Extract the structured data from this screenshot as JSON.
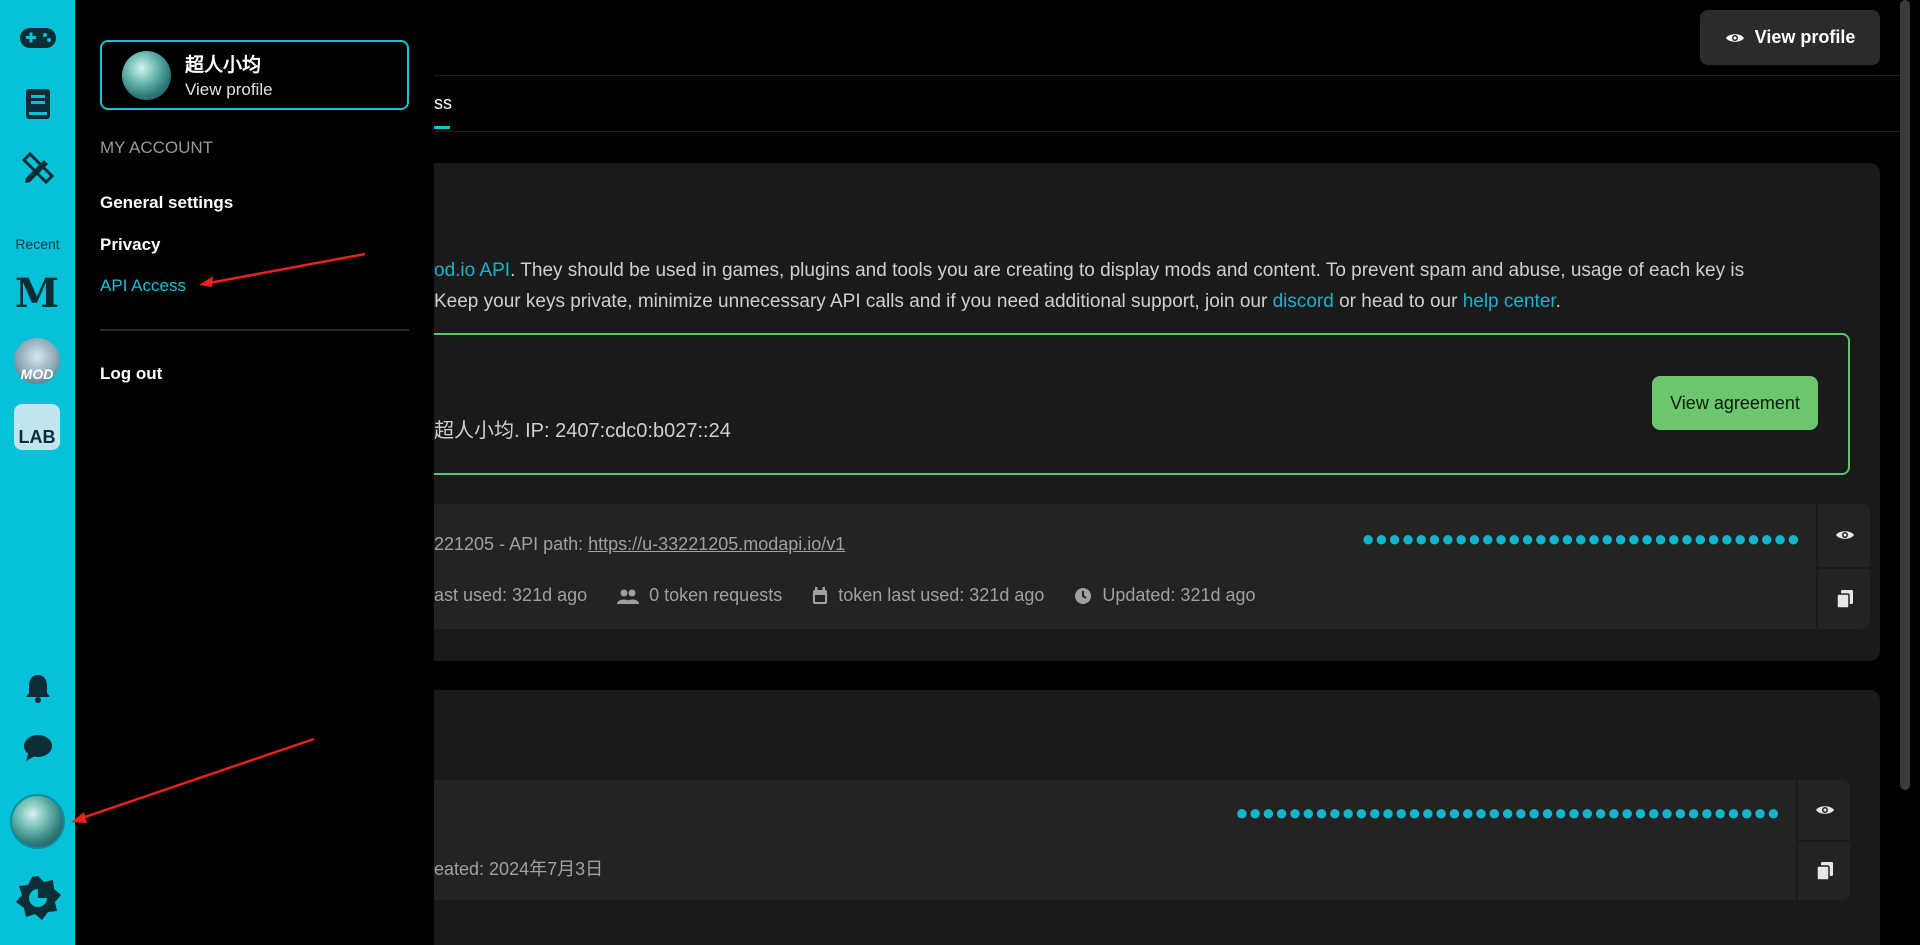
{
  "rail": {
    "recent_label": "Recent",
    "recent_tiles": [
      {
        "name": "M",
        "label": "M"
      },
      {
        "name": "MOD",
        "label": "MOD"
      },
      {
        "name": "LAB",
        "label": "LAB"
      }
    ]
  },
  "menu": {
    "profile_name": "超人小均",
    "profile_link": "View profile",
    "heading": "MY ACCOUNT",
    "items": [
      {
        "label": "General settings"
      },
      {
        "label": "Privacy"
      },
      {
        "label": "API Access"
      }
    ],
    "logout": "Log out"
  },
  "main": {
    "view_profile_label": "View profile",
    "tab_fragment": "ss",
    "description_part1": "od.io API",
    "description_part2": ". They should be used in games, plugins and tools you are creating to display mods and content. To prevent spam and abuse, usage of each key is",
    "description_part3": " Keep your keys private, minimize unnecessary API calls and if you need additional support, join our ",
    "description_link_discord": "discord",
    "description_part4": " or head to our ",
    "description_link_help": "help center",
    "description_part5": ".",
    "agreement_owner": "超人小均. IP: 2407:cdc0:b027::24",
    "agreement_button": "View agreement",
    "key1": {
      "path_prefix": "221205 - API path: ",
      "path_url": "https://u-33221205.modapi.io/v1",
      "masked": "●●●●●●●●●●●●●●●●●●●●●●●●●●●●●●●●●",
      "meta_last_used": "ast used: 321d ago",
      "meta_requests": "0 token requests",
      "meta_token_last_used": "token last used: 321d ago",
      "meta_updated": "Updated: 321d ago"
    },
    "key2": {
      "masked": "●●●●●●●●●●●●●●●●●●●●●●●●●●●●●●●●●●●●●●●●●",
      "created": "eated: 2024年7月3日"
    }
  },
  "colors": {
    "rail": "#07c1d8",
    "accent": "#13c3d8",
    "agree_green": "#6cc76e"
  }
}
